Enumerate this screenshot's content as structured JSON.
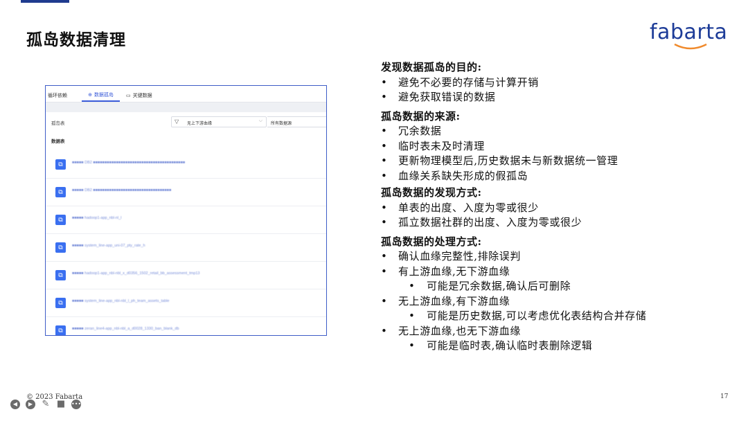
{
  "slide": {
    "title": "孤岛数据清理",
    "brand": "fabarta",
    "copyright": "© 2023 Fabarta",
    "page_number": "17"
  },
  "app": {
    "tabs": [
      {
        "label": "循环依赖",
        "active": false,
        "icon": ""
      },
      {
        "label": "数据孤岛",
        "active": true,
        "icon": "target-icon"
      },
      {
        "label": "关键数据",
        "active": false,
        "icon": "table-icon"
      }
    ],
    "filter_label": "孤岛表",
    "filter_value": "无上下游血缘",
    "source_select": "所有数据源",
    "list_header": "数据表",
    "rows": [
      "■■■■■ DB2 ■■■■■■■■■■■■■■■■■■■■■■■■■■■■■■■■■■■■■■■■",
      "■■■■■ DB2 ■■■■■■■■■■■■■■■■■■■■■■■■■■■■■■■■■■",
      "■■■■■ hadoop1-app_nbl-nl_l",
      "■■■■■ system_line-app_uni-07_pty_rate_h",
      "■■■■■ hadoop1-app_nbl-nbl_x_d0356_1502_retail_bb_assessment_tmp13",
      "■■■■■ system_line-app_nbl-nbl_l_ph_team_assets_table",
      "■■■■■ zeran_line4-app_nbl-nbl_a_d0028_1330_ban_blank_db"
    ]
  },
  "notes": {
    "purpose_heading": "发现数据孤岛的目的:",
    "purpose_items": [
      "避免不必要的存储与计算开销",
      "避免获取错误的数据"
    ],
    "source_heading": "孤岛数据的来源:",
    "source_items": [
      "冗余数据",
      "临时表未及时清理",
      "更新物理模型后,历史数据未与新数据统一管理",
      "血缘关系缺失形成的假孤岛"
    ],
    "discover_heading": "孤岛数据的发现方式:",
    "discover_items": [
      "单表的出度、入度为零或很少",
      "孤立数据社群的出度、入度为零或很少"
    ],
    "handle_heading": "孤岛数据的处理方式:",
    "handle_items": [
      {
        "text": "确认血缘完整性,排除误判",
        "sub": ""
      },
      {
        "text": "有上游血缘,无下游血缘",
        "sub": "可能是冗余数据,确认后可删除"
      },
      {
        "text": "无上游血缘,有下游血缘",
        "sub": "可能是历史数据,可以考虑优化表结构合并存储"
      },
      {
        "text": "无上游血缘,也无下游血缘",
        "sub": "可能是临时表,确认临时表删除逻辑"
      }
    ]
  },
  "player_controls": [
    "prev-icon",
    "next-icon",
    "pen-icon",
    "video-icon",
    "more-icon"
  ],
  "colors": {
    "brand": "#1d3c98",
    "accent": "#3a5bd9",
    "row_icon": "#3a6ff0"
  }
}
